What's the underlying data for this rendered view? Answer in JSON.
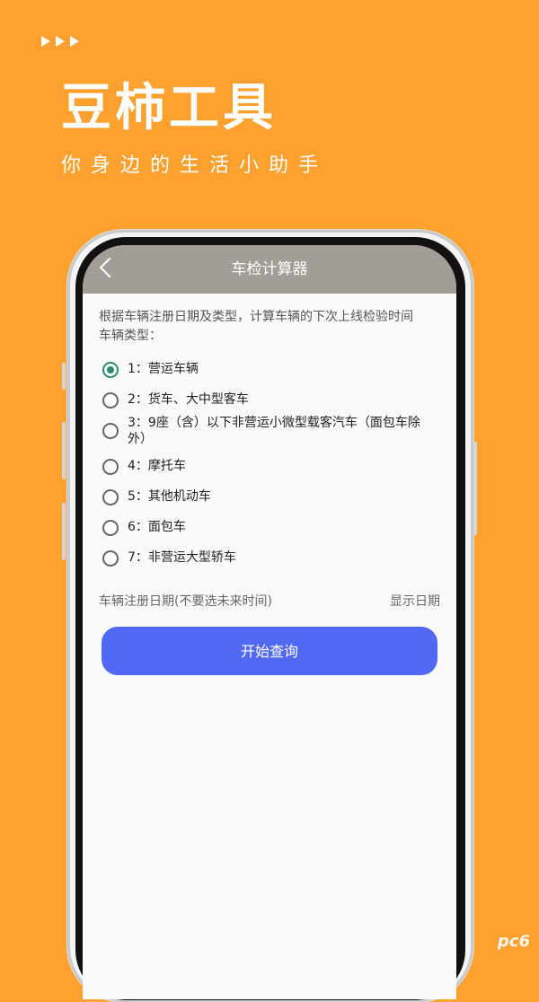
{
  "promo": {
    "title": "豆柿工具",
    "subtitle": "你身边的生活小助手"
  },
  "app_bar": {
    "title": "车检计算器",
    "back_icon": "chevron-left-icon"
  },
  "content": {
    "description": "根据车辆注册日期及类型，计算车辆的下次上线检验时间",
    "type_label": "车辆类型：",
    "options": [
      {
        "label": "1：营运车辆",
        "checked": true
      },
      {
        "label": "2：货车、大中型客车",
        "checked": false
      },
      {
        "label": "3：9座（含）以下非营运小微型载客汽车（面包车除外）",
        "checked": false
      },
      {
        "label": "4：摩托车",
        "checked": false
      },
      {
        "label": "5：其他机动车",
        "checked": false
      },
      {
        "label": "6：面包车",
        "checked": false
      },
      {
        "label": "7：非营运大型轿车",
        "checked": false
      }
    ],
    "date_label": "车辆注册日期(不要选未来时间)",
    "date_value": "显示日期",
    "query_button": "开始查询"
  },
  "watermark": "pc6",
  "colors": {
    "background": "#FFA12E",
    "app_bar": "#A19F95",
    "button": "#5168F2",
    "radio_checked": "#2E8B6E"
  }
}
